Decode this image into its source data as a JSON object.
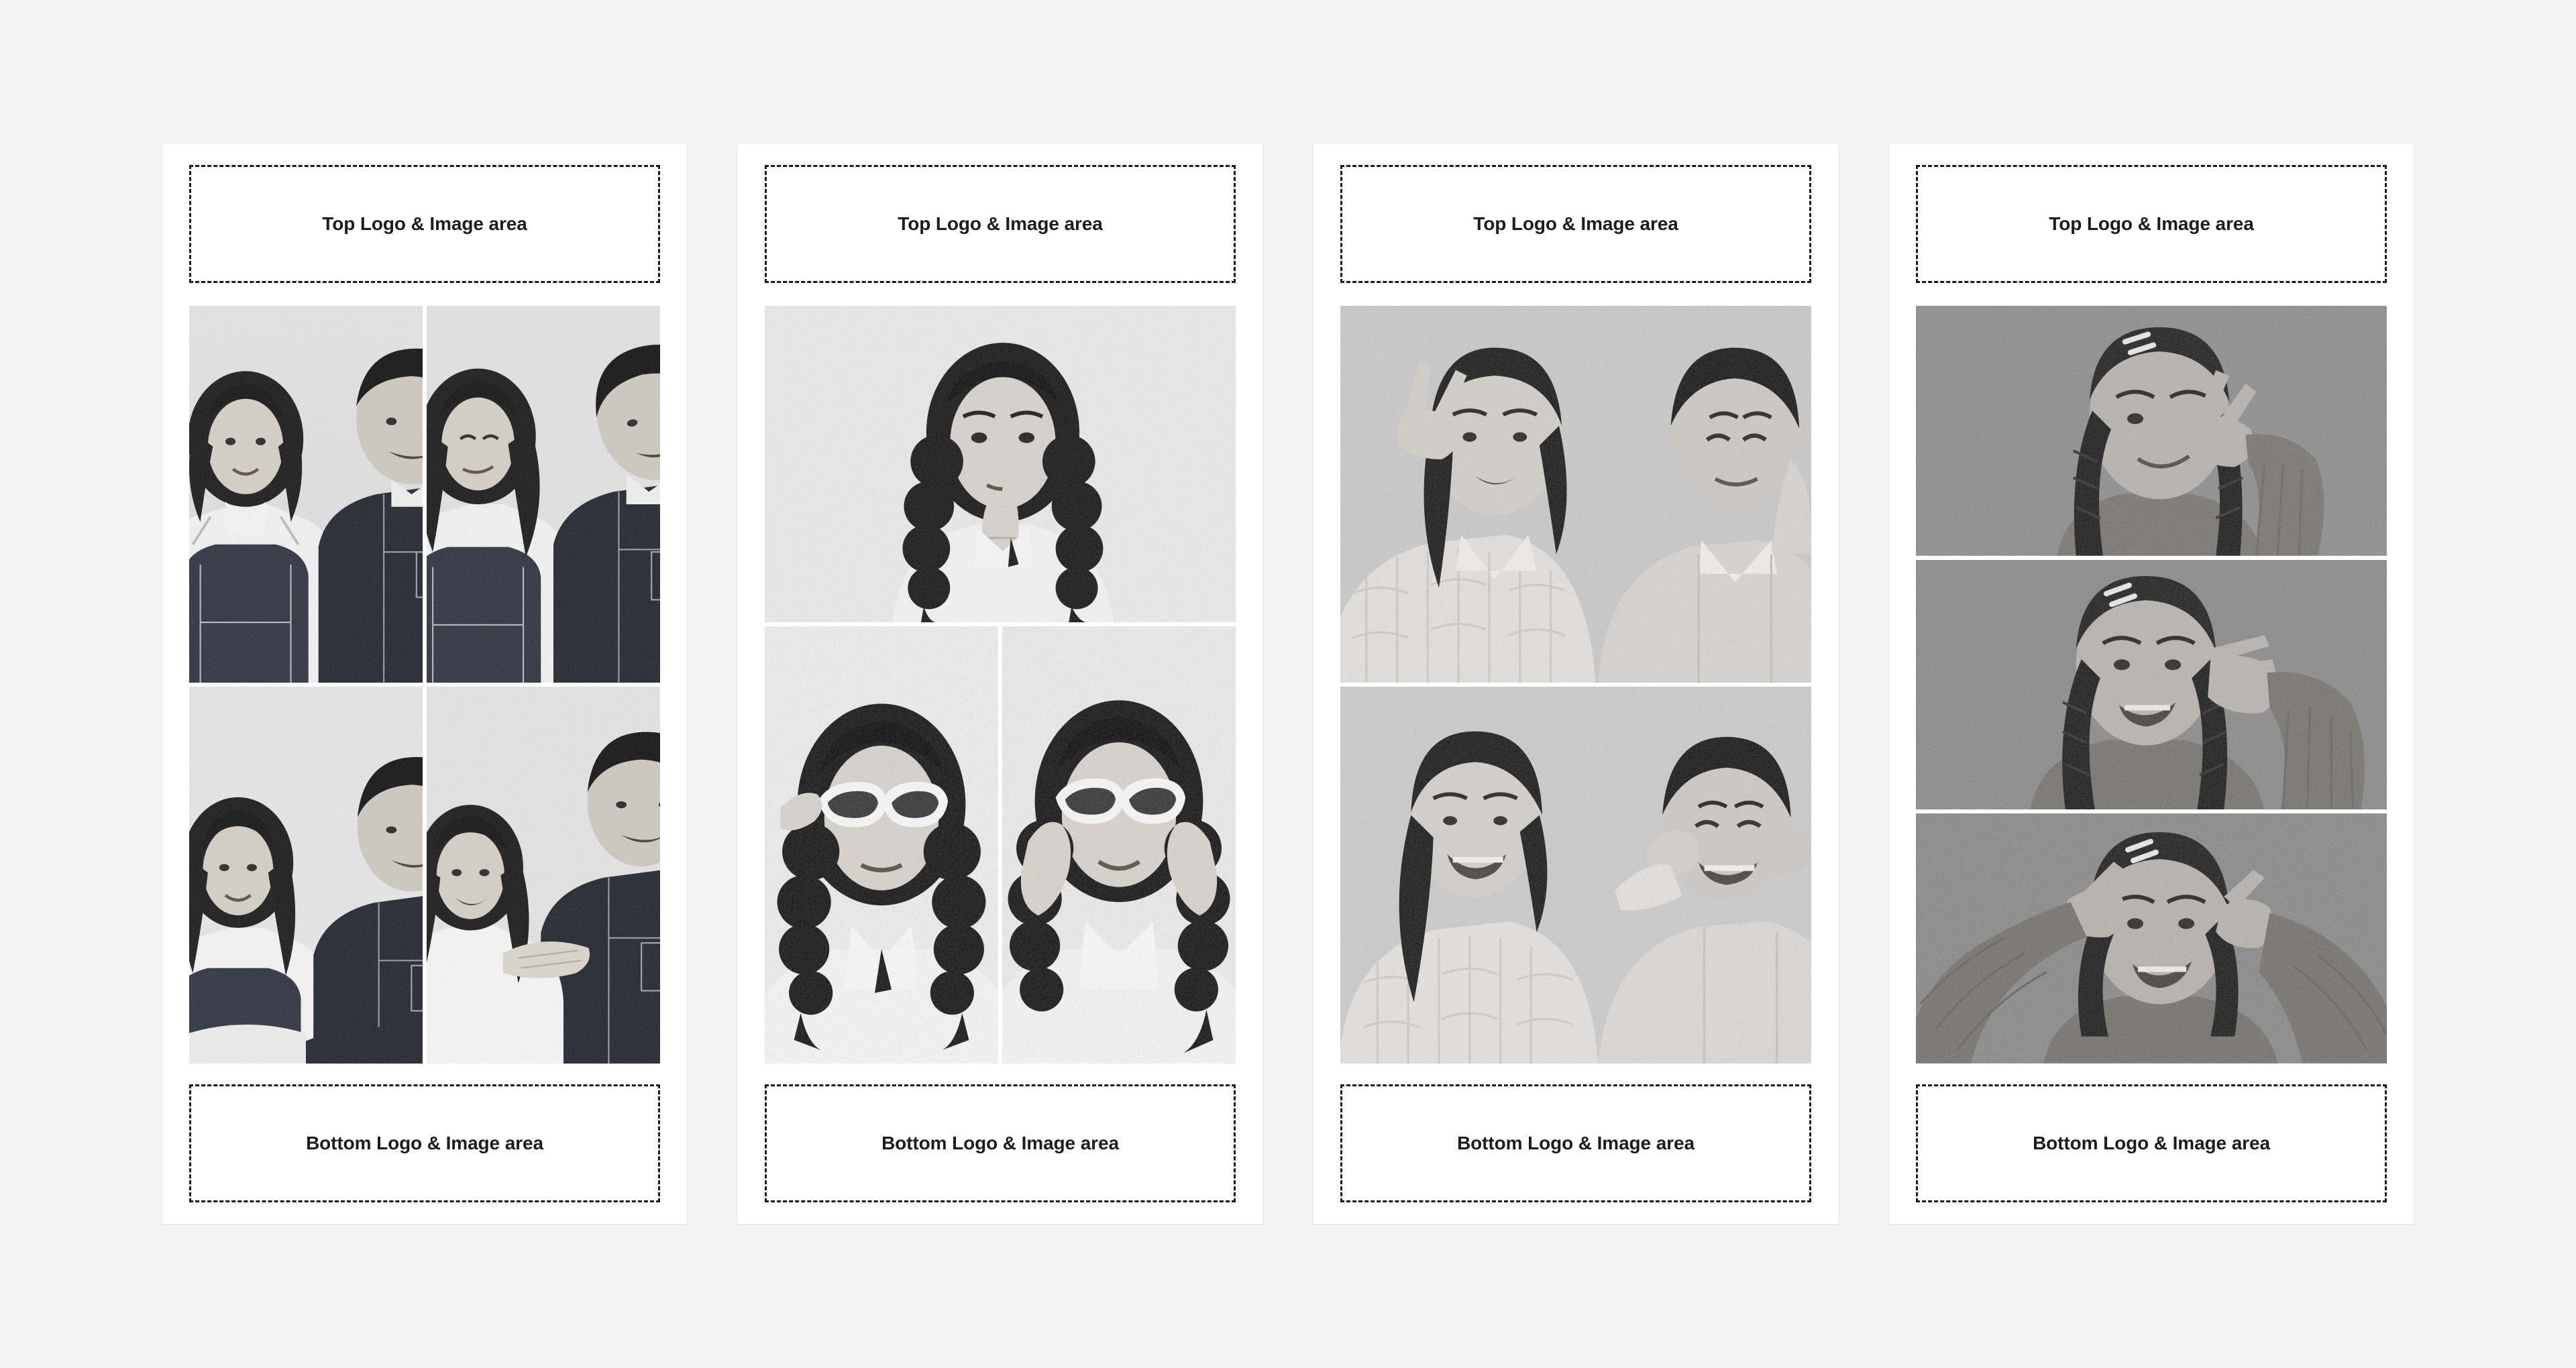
{
  "page": {
    "background_color": "#f4f4f4",
    "card_background_color": "#ffffff",
    "text_color": "#1d1d1d",
    "dashed_border_color": "#1a1a1a"
  },
  "labels": {
    "top_logo_area": "Top Logo & Image area",
    "bottom_logo_area": "Bottom Logo & Image area"
  },
  "cards": [
    {
      "id": "strip-1",
      "top_label": "Top Logo & Image area",
      "bottom_label": "Bottom Logo & Image area",
      "layout": "grid-2x2",
      "photo_count": 4,
      "photo_style": "light-background black-and-white grainy",
      "photos": [
        {
          "name": "couple-smiling-top-left",
          "subject": "couple",
          "tone": "light"
        },
        {
          "name": "couple-playful-top-right",
          "subject": "couple",
          "tone": "light"
        },
        {
          "name": "couple-leaning-bottom-left",
          "subject": "couple",
          "tone": "light"
        },
        {
          "name": "couple-hugging-bottom-right",
          "subject": "couple",
          "tone": "light"
        }
      ]
    },
    {
      "id": "strip-2",
      "top_label": "Top Logo & Image area",
      "bottom_label": "Bottom Logo & Image area",
      "layout": "wide-top-two-bottom",
      "photo_count": 3,
      "photo_style": "light-background black-and-white grainy",
      "photos": [
        {
          "name": "girl-braids-shush-wide",
          "subject": "girl with braids",
          "tone": "light"
        },
        {
          "name": "girl-sunglasses-left",
          "subject": "girl with sunglasses",
          "tone": "light"
        },
        {
          "name": "girl-sunglasses-right",
          "subject": "girl with sunglasses",
          "tone": "light"
        }
      ]
    },
    {
      "id": "strip-3",
      "top_label": "Top Logo & Image area",
      "bottom_label": "Bottom Logo & Image area",
      "layout": "two-wide-stack",
      "photo_count": 2,
      "photo_style": "mid-gray-background black-and-white grainy",
      "photos": [
        {
          "name": "couple-peace-signs-top",
          "subject": "couple",
          "tone": "mid"
        },
        {
          "name": "couple-funny-faces-bottom",
          "subject": "couple",
          "tone": "mid"
        }
      ]
    },
    {
      "id": "strip-4",
      "top_label": "Top Logo & Image area",
      "bottom_label": "Bottom Logo & Image area",
      "layout": "three-wide-stack",
      "photo_count": 3,
      "photo_style": "dark-gray-background black-and-white grainy",
      "photos": [
        {
          "name": "girl-braids-peace-eye",
          "subject": "girl with braids",
          "tone": "dark"
        },
        {
          "name": "girl-braids-hand-frame",
          "subject": "girl with braids",
          "tone": "dark"
        },
        {
          "name": "girl-braids-both-hands",
          "subject": "girl with braids",
          "tone": "dark"
        }
      ]
    }
  ]
}
